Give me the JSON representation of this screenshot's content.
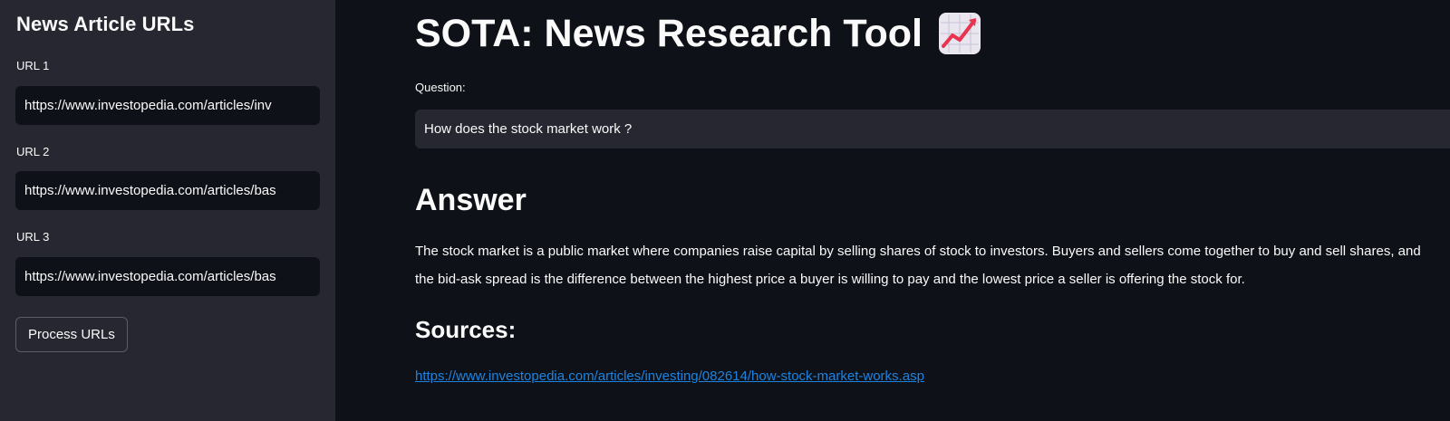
{
  "sidebar": {
    "title": "News Article URLs",
    "urls": [
      {
        "label": "URL 1",
        "value": "https://www.investopedia.com/articles/inv"
      },
      {
        "label": "URL 2",
        "value": "https://www.investopedia.com/articles/bas"
      },
      {
        "label": "URL 3",
        "value": "https://www.investopedia.com/articles/bas"
      }
    ],
    "process_button": "Process URLs"
  },
  "main": {
    "title": "SOTA: News Research Tool",
    "title_icon": "chart-increasing-icon",
    "question_label": "Question:",
    "question_value": "How does the stock market work ?",
    "answer_heading": "Answer",
    "answer_text": "The stock market is a public market where companies raise capital by selling shares of stock to investors. Buyers and sellers come together to buy and sell shares, and the bid-ask spread is the difference between the highest price a buyer is willing to pay and the lowest price a seller is offering the stock for.",
    "sources_heading": "Sources:",
    "source_link": "https://www.investopedia.com/articles/investing/082614/how-stock-market-works.asp"
  },
  "colors": {
    "background": "#0e1117",
    "sidebar": "#262730",
    "input_dark": "#0e1117",
    "input_main": "#262730",
    "text": "#fafafa",
    "link": "#1c83e1",
    "icon_line": "#e8344e"
  }
}
